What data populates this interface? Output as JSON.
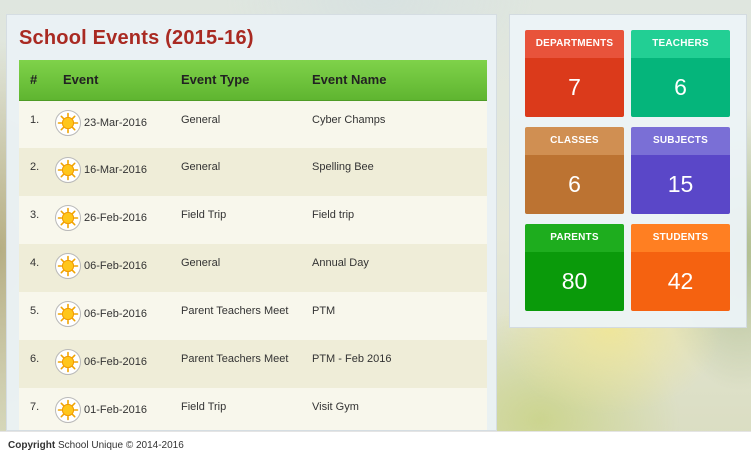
{
  "events": {
    "title": "School Events (2015-16)",
    "columns": [
      "#",
      "Event",
      "Event Type",
      "Event Name"
    ],
    "rows": [
      {
        "num": "1.",
        "date": "23-Mar-2016",
        "type": "General",
        "name": "Cyber Champs"
      },
      {
        "num": "2.",
        "date": "16-Mar-2016",
        "type": "General",
        "name": "Spelling Bee"
      },
      {
        "num": "3.",
        "date": "26-Feb-2016",
        "type": "Field Trip",
        "name": "Field trip"
      },
      {
        "num": "4.",
        "date": "06-Feb-2016",
        "type": "General",
        "name": "Annual Day"
      },
      {
        "num": "5.",
        "date": "06-Feb-2016",
        "type": "Parent Teachers Meet",
        "name": "PTM"
      },
      {
        "num": "6.",
        "date": "06-Feb-2016",
        "type": "Parent Teachers Meet",
        "name": "PTM - Feb 2016"
      },
      {
        "num": "7.",
        "date": "01-Feb-2016",
        "type": "Field Trip",
        "name": "Visit Gym"
      }
    ],
    "row_icon": "sun-icon"
  },
  "stats": [
    {
      "label": "DEPARTMENTS",
      "value": "7",
      "head_color": "#e8533b",
      "body_color": "#db3a1b"
    },
    {
      "label": "TEACHERS",
      "value": "6",
      "head_color": "#22cf94",
      "body_color": "#05b57b"
    },
    {
      "label": "CLASSES",
      "value": "6",
      "head_color": "#d08f52",
      "body_color": "#bc7332"
    },
    {
      "label": "SUBJECTS",
      "value": "15",
      "head_color": "#7a6fd6",
      "body_color": "#5a47c8"
    },
    {
      "label": "PARENTS",
      "value": "80",
      "head_color": "#1ead1e",
      "body_color": "#0a9a0a"
    },
    {
      "label": "STUDENTS",
      "value": "42",
      "head_color": "#ff7f22",
      "body_color": "#f56210"
    }
  ],
  "footer": {
    "copyright_label": "Copyright",
    "text": "School Unique © 2014-2016"
  },
  "colors": {
    "title": "#a92a22",
    "table_header": "#6cc23a",
    "row_odd": "#f8f7ec",
    "row_even": "#efedd8"
  }
}
